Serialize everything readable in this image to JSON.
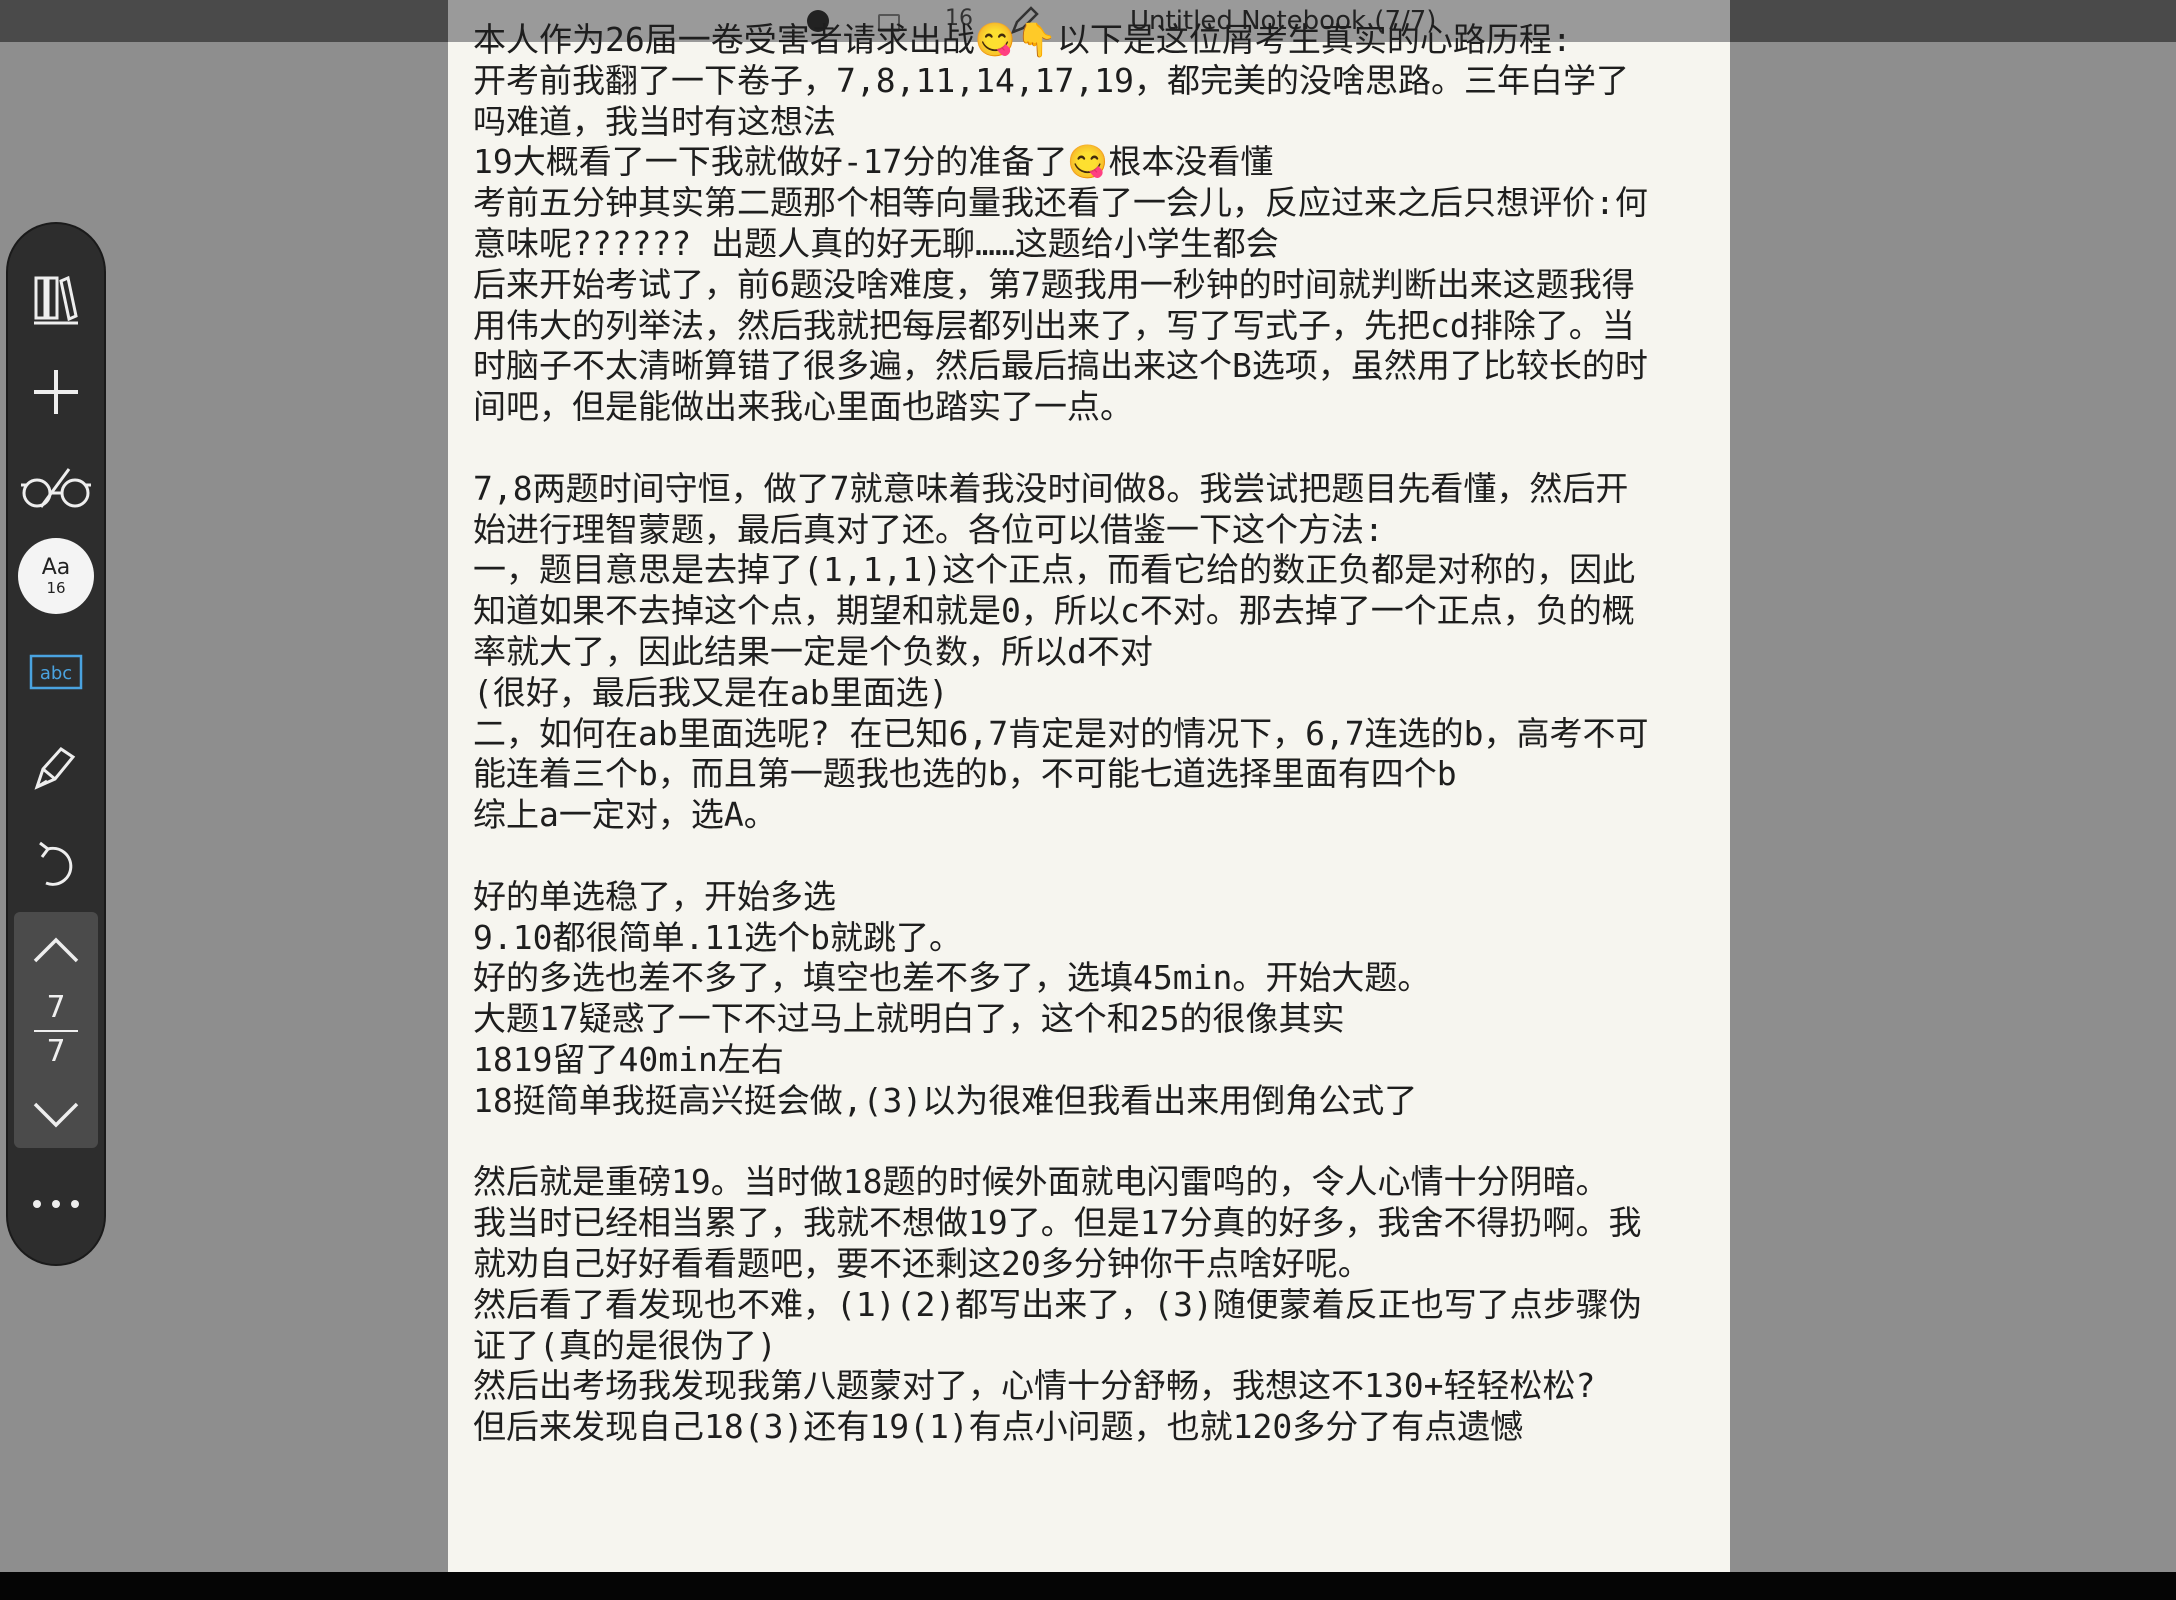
{
  "window": {
    "title": "Untitled Notebook (7/7)",
    "font_size_indicator": "16"
  },
  "toolbar": {
    "font_button_label": "Aa",
    "font_button_size": "16",
    "abc_label": "abc",
    "current_page": "7",
    "total_pages": "7"
  },
  "colors": {
    "paper": "#f6f5ef",
    "toolbar": "#2d2d2d",
    "accent_abc": "#4aa3e0"
  },
  "note_lines": [
    "本人作为26届一卷受害者请求出战😋👇以下是这位屑考生真实的心路历程:",
    "开考前我翻了一下卷子，7,8,11,14,17,19，都完美的没啥思路。三年白学了",
    "吗难道，我当时有这想法",
    "19大概看了一下我就做好-17分的准备了😋根本没看懂",
    "考前五分钟其实第二题那个相等向量我还看了一会儿，反应过来之后只想评价:何",
    "意味呢?????? 出题人真的好无聊……这题给小学生都会",
    "后来开始考试了，前6题没啥难度，第7题我用一秒钟的时间就判断出来这题我得",
    "用伟大的列举法，然后我就把每层都列出来了，写了写式子，先把cd排除了。当",
    "时脑子不太清晰算错了很多遍，然后最后搞出来这个B选项，虽然用了比较长的时",
    "间吧，但是能做出来我心里面也踏实了一点。",
    "",
    "7,8两题时间守恒，做了7就意味着我没时间做8。我尝试把题目先看懂，然后开",
    "始进行理智蒙题，最后真对了还。各位可以借鉴一下这个方法:",
    "一，题目意思是去掉了(1,1,1)这个正点，而看它给的数正负都是对称的，因此",
    "知道如果不去掉这个点，期望和就是0，所以c不对。那去掉了一个正点，负的概",
    "率就大了，因此结果一定是个负数，所以d不对",
    "(很好，最后我又是在ab里面选)",
    "二，如何在ab里面选呢? 在已知6,7肯定是对的情况下，6,7连选的b，高考不可",
    "能连着三个b，而且第一题我也选的b，不可能七道选择里面有四个b",
    "综上a一定对，选A。",
    "",
    "好的单选稳了，开始多选",
    "9.10都很简单.11选个b就跳了。",
    "好的多选也差不多了，填空也差不多了，选填45min。开始大题。",
    "大题17疑惑了一下不过马上就明白了，这个和25的很像其实",
    "1819留了40min左右",
    "18挺简单我挺高兴挺会做,(3)以为很难但我看出来用倒角公式了",
    "",
    "然后就是重磅19。当时做18题的时候外面就电闪雷鸣的，令人心情十分阴暗。",
    "我当时已经相当累了，我就不想做19了。但是17分真的好多，我舍不得扔啊。我",
    "就劝自己好好看看题吧，要不还剩这20多分钟你干点啥好呢。",
    "然后看了看发现也不难，(1)(2)都写出来了，(3)随便蒙着反正也写了点步骤伪",
    "证了(真的是很伪了)",
    "然后出考场我发现我第八题蒙对了，心情十分舒畅，我想这不130+轻轻松松?",
    "但后来发现自己18(3)还有19(1)有点小问题，也就120多分了有点遗憾"
  ]
}
